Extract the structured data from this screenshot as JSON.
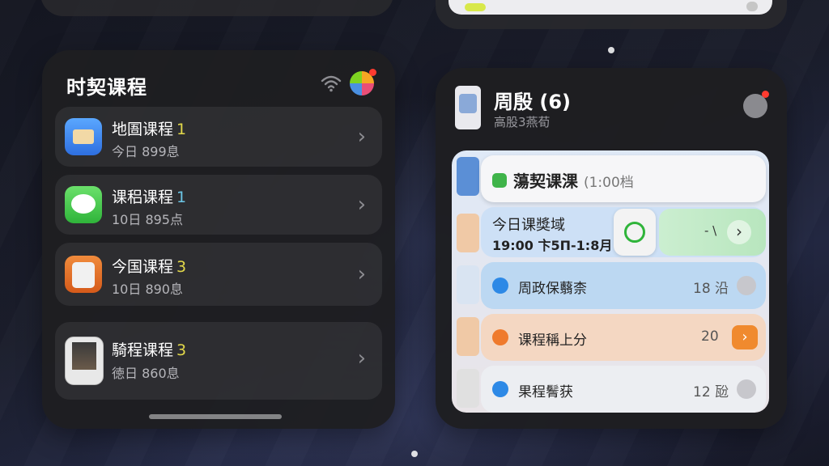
{
  "left_widget": {
    "title": "时契课程",
    "rows": [
      {
        "name": "地圄课程",
        "num": "1",
        "sub": "今日 899息",
        "icon": "briefcase-icon"
      },
      {
        "name": "课稆课程",
        "num": "1",
        "sub": "10日 895点",
        "icon": "messages-icon"
      },
      {
        "name": "今国课程",
        "num": "3",
        "sub": "10日 890息",
        "icon": "bag-icon"
      },
      {
        "name": "騎程课程",
        "num": "3",
        "sub": "徳日 860息",
        "icon": "photo-icon"
      }
    ]
  },
  "right_widget": {
    "title": "周殷 (6)",
    "subtitle": "高股3燕荀",
    "cards": [
      {
        "title": "蕩契课淉",
        "extra": "(1:00档"
      },
      {
        "line1": "今日课獎域",
        "line2": "19:00 卞5Π-1:8月",
        "action_text": "- \\"
      },
      {
        "label": "周政保蘙柰",
        "value": "18 沿"
      },
      {
        "label": "课程稱上分",
        "value": "20"
      },
      {
        "label": "果程鬌获",
        "value": "12 瓰"
      }
    ]
  },
  "colors": {
    "accent_green": "#3fb44a",
    "accent_orange": "#f08a2e",
    "accent_blue": "#2d89e6",
    "number_yellow": "#e2d84a"
  }
}
